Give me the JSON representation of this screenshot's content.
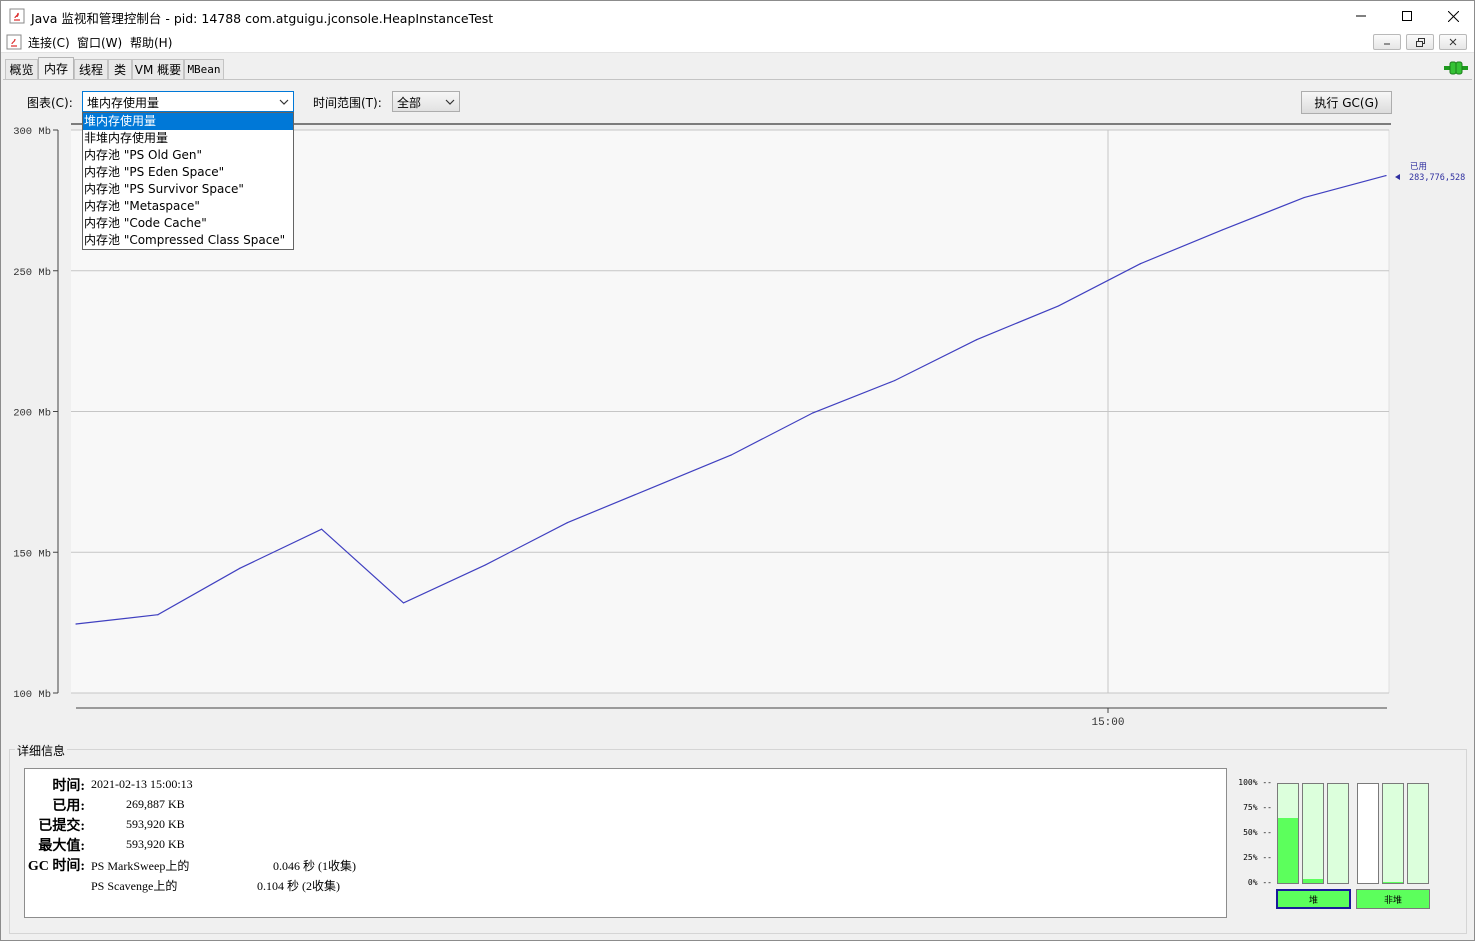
{
  "window": {
    "title": "Java 监视和管理控制台 - pid: 14788 com.atguigu.jconsole.HeapInstanceTest"
  },
  "menubar": {
    "items": [
      "连接(C)",
      "窗口(W)",
      "帮助(H)"
    ]
  },
  "tabs": [
    {
      "label": "概览",
      "active": false
    },
    {
      "label": "内存",
      "active": true
    },
    {
      "label": "线程",
      "active": false
    },
    {
      "label": "类",
      "active": false
    },
    {
      "label": "VM 概要",
      "active": false
    },
    {
      "label": "MBean",
      "active": false
    }
  ],
  "controls": {
    "chart_label": "图表(C):",
    "chart_selected": "堆内存使用量",
    "range_label": "时间范围(T):",
    "range_selected": "全部",
    "gc_button": "执行 GC(G)"
  },
  "dropdown": {
    "items": [
      "堆内存使用量",
      "非堆内存使用量",
      "内存池 \"PS Old Gen\"",
      "内存池 \"PS Eden Space\"",
      "内存池 \"PS Survivor Space\"",
      "内存池 \"Metaspace\"",
      "内存池 \"Code Cache\"",
      "内存池 \"Compressed Class Space\""
    ],
    "selected_index": 0
  },
  "chart_data": {
    "type": "line",
    "y_unit": "Mb",
    "ylim": [
      100,
      300
    ],
    "y_ticks": [
      "300 Mb",
      "250 Mb",
      "200 Mb",
      "150 Mb",
      "100 Mb"
    ],
    "x_ticks": [
      "15:00"
    ],
    "grid": true,
    "series": [
      {
        "name": "已用",
        "color": "#4040c0",
        "values": [
          124.5,
          127.8,
          144.3,
          158.2,
          132.0,
          145.5,
          160.5,
          172.5,
          184.5,
          199.5,
          211.0,
          225.5,
          237.5,
          252.5,
          264.5,
          276.0,
          283.8
        ]
      }
    ],
    "latest_label": "已用",
    "latest_value": "283,776,528"
  },
  "details": {
    "legend": "详细信息",
    "rows": [
      {
        "key": "时间:",
        "value": "2021-02-13 15:00:13"
      },
      {
        "key": "已用:",
        "value": "269,887 KB"
      },
      {
        "key": "已提交:",
        "value": "593,920 KB"
      },
      {
        "key": "最大值:",
        "value": "593,920 KB"
      },
      {
        "key": "GC 时间:",
        "value": "PS MarkSweep上的",
        "extra": "0.046 秒 (1收集)"
      },
      {
        "key": "",
        "value": "PS Scavenge上的",
        "extra": "0.104 秒 (2收集)"
      }
    ]
  },
  "gauges": {
    "pct_labels": [
      "100% --",
      "75% --",
      "50% --",
      "25% --",
      "0% --"
    ],
    "heap_label": "堆",
    "nonheap_label": "非堆",
    "heap_bars": [
      0.66,
      0.04,
      0.0
    ],
    "nonheap_bars": [
      0.0,
      0.01,
      0.0
    ]
  },
  "colors": {
    "series_line": "#4040c0",
    "gauge_fill": "#5cff5c",
    "selection": "#0078d7"
  }
}
